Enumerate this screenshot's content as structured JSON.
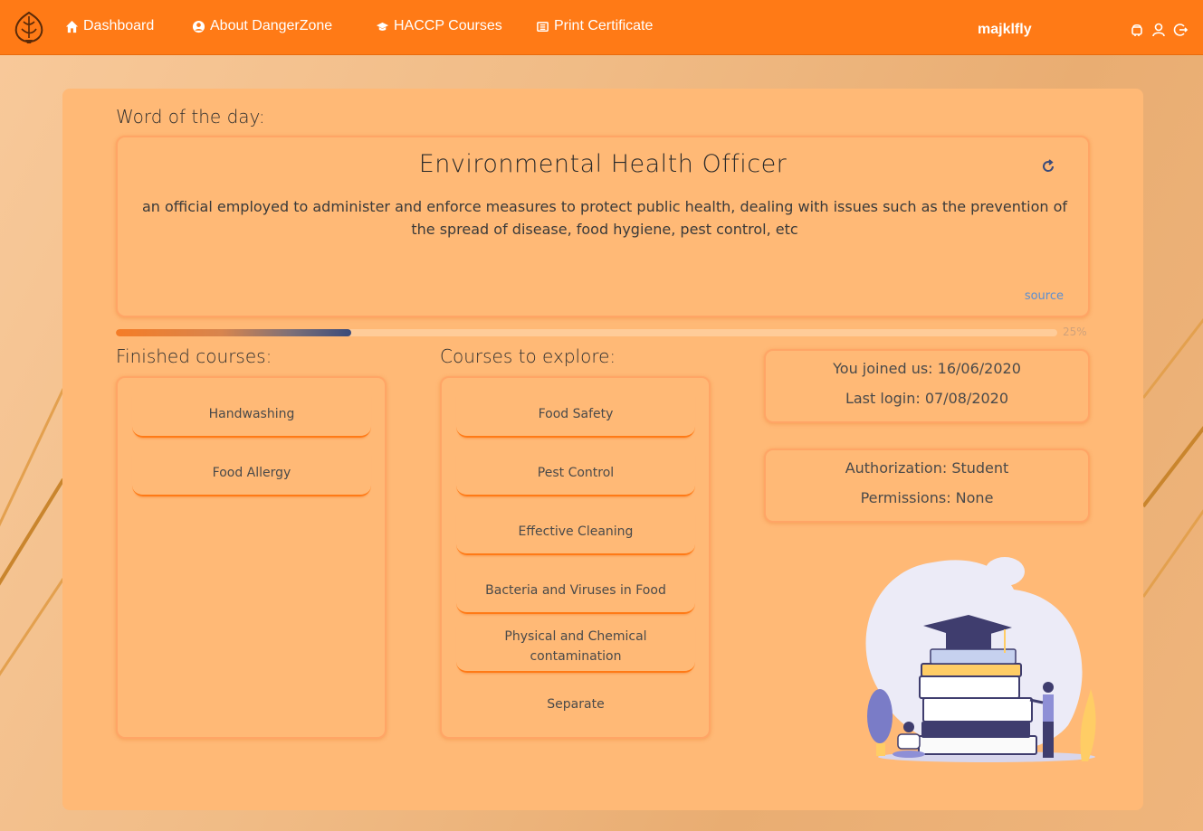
{
  "nav": {
    "items": [
      {
        "label": "Dashboard",
        "icon": "home-icon"
      },
      {
        "label": "About DangerZone",
        "icon": "user-circle-icon"
      },
      {
        "label": "HACCP Courses",
        "icon": "graduation-cap-icon"
      },
      {
        "label": "Print Certificate",
        "icon": "newspaper-icon"
      }
    ],
    "username": "majklfly",
    "right_icons": [
      "android-icon",
      "user-icon",
      "logout-icon"
    ]
  },
  "word_of_day": {
    "heading": "Word of the day:",
    "word": "Environmental Health Officer",
    "definition": "an official employed to administer and enforce measures to protect public health, dealing with issues such as the prevention of the spread of disease, food hygiene, pest control, etc",
    "source_label": "source"
  },
  "progress": {
    "value": 0.25,
    "label": "25%"
  },
  "finished": {
    "heading": "Finished courses:",
    "items": [
      "Handwashing",
      "Food Allergy"
    ]
  },
  "explore": {
    "heading": "Courses to explore:",
    "items": [
      "Food Safety",
      "Pest Control",
      "Effective Cleaning",
      "Bacteria and Viruses in Food",
      "Physical and Chemical contamination",
      "Separate"
    ]
  },
  "account": {
    "joined": "You joined us: 16/06/2020",
    "last_login": "Last login: 07/08/2020",
    "authorization": "Authorization: Student",
    "permissions": "Permissions: None"
  },
  "colors": {
    "navbar": "#ff7a16",
    "panel": "#ffb976",
    "accent_line": "#ff7a16",
    "progress_end": "#3a4b7a"
  }
}
